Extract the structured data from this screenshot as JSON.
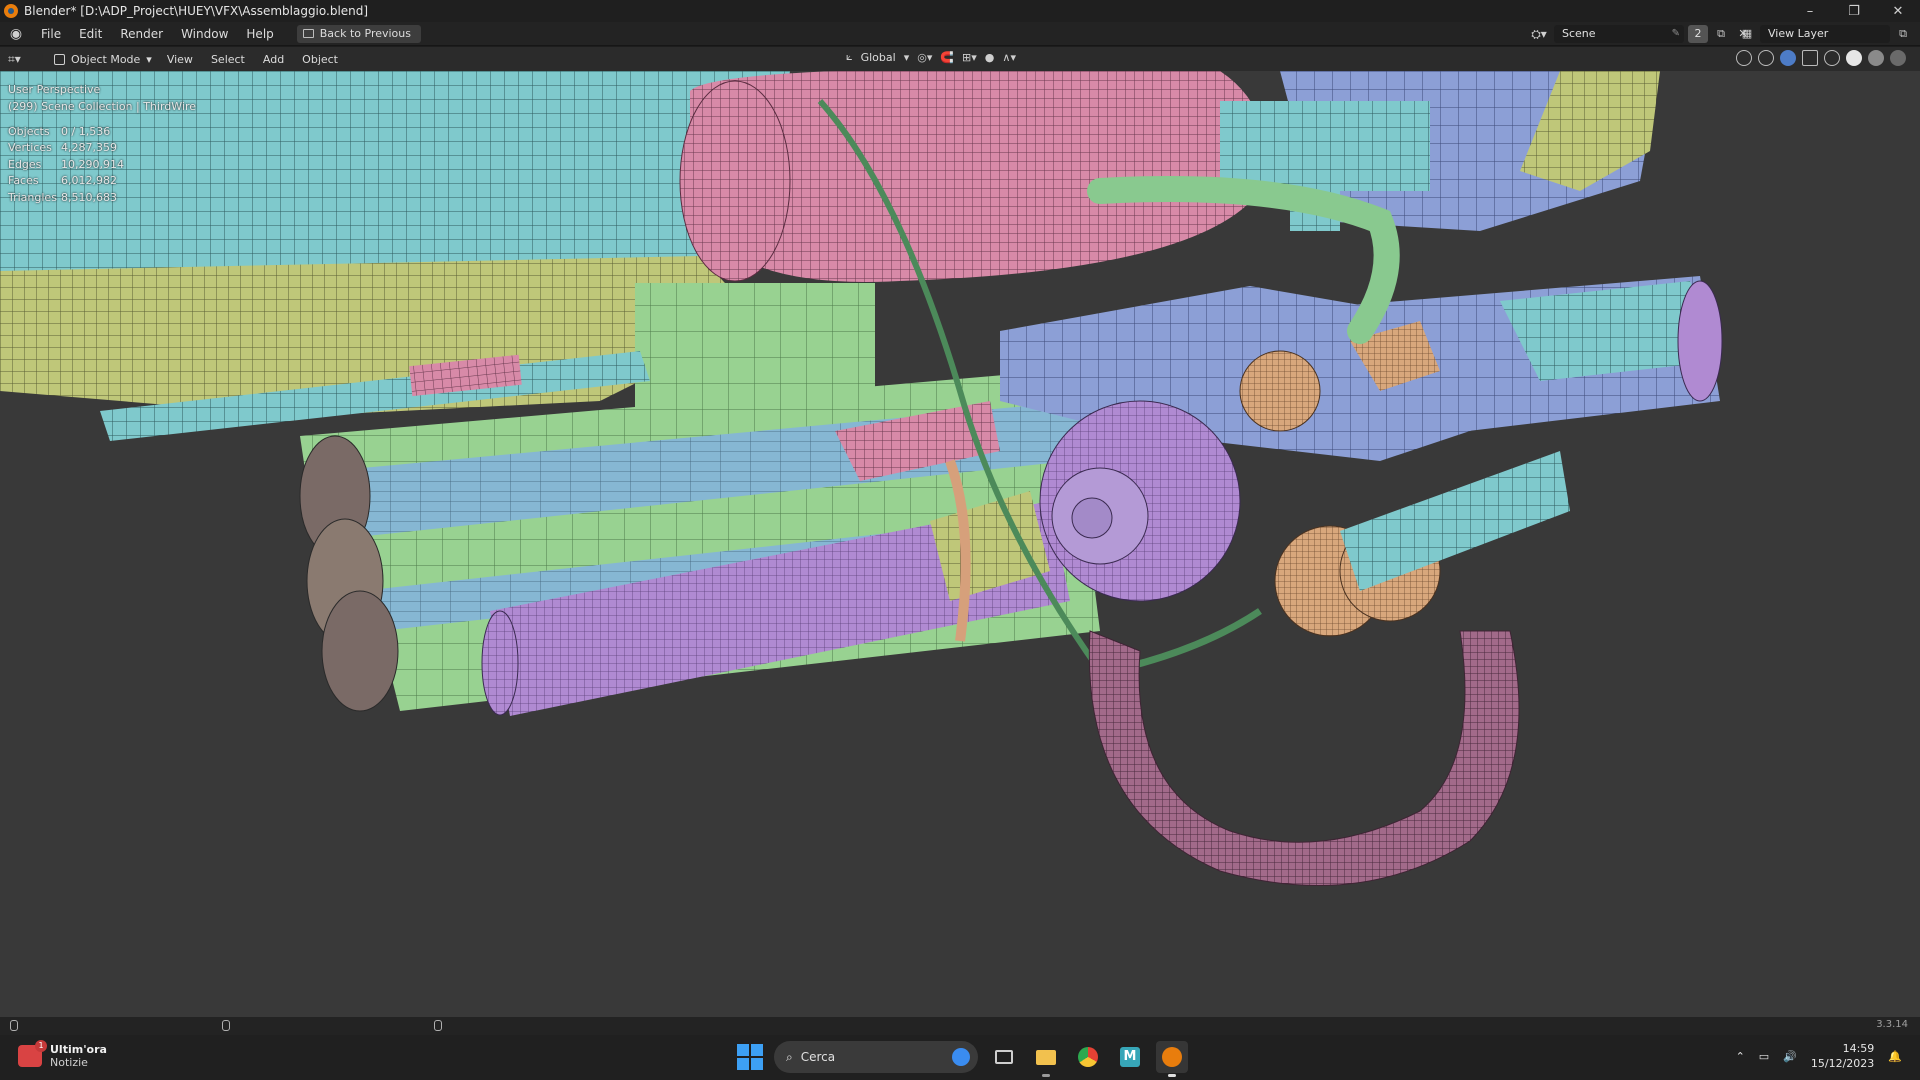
{
  "window": {
    "title": "Blender* [D:\\ADP_Project\\HUEY\\VFX\\Assemblaggio.blend]",
    "controls": [
      "–",
      "❐",
      "✕"
    ]
  },
  "menubar": {
    "items": [
      "File",
      "Edit",
      "Render",
      "Window",
      "Help"
    ],
    "back_button": "Back to Previous",
    "scene": "Scene",
    "scene_users": "2",
    "view_layer": "View Layer"
  },
  "viewport_header": {
    "mode": "Object Mode",
    "menus": [
      "View",
      "Select",
      "Add",
      "Object"
    ],
    "orientation": "Global"
  },
  "viewport": {
    "perspective": "User Perspective",
    "collection": "(299) Scene Collection | ThirdWire",
    "stats": [
      {
        "label": "Objects",
        "value": "0 / 1,536"
      },
      {
        "label": "Vertices",
        "value": "4,287,359"
      },
      {
        "label": "Edges",
        "value": "10,290,914"
      },
      {
        "label": "Faces",
        "value": "6,012,982"
      },
      {
        "label": "Triangles",
        "value": "8,510,683"
      }
    ]
  },
  "statusbar": {
    "version": "3.3.14"
  },
  "taskbar": {
    "news_title": "Ultim'ora",
    "news_subtitle": "Notizie",
    "search_placeholder": "Cerca",
    "time": "14:59",
    "date": "15/12/2023"
  },
  "colors": {
    "viewport_bg": "#393939",
    "mesh_pink": "#d38aa6",
    "mesh_cyan": "#7fd0d0",
    "mesh_green": "#8fd08a",
    "mesh_blue": "#8fa6d8",
    "mesh_purple": "#a88ad0",
    "mesh_orange": "#d8a378",
    "mesh_yellow": "#c8cf7a"
  }
}
